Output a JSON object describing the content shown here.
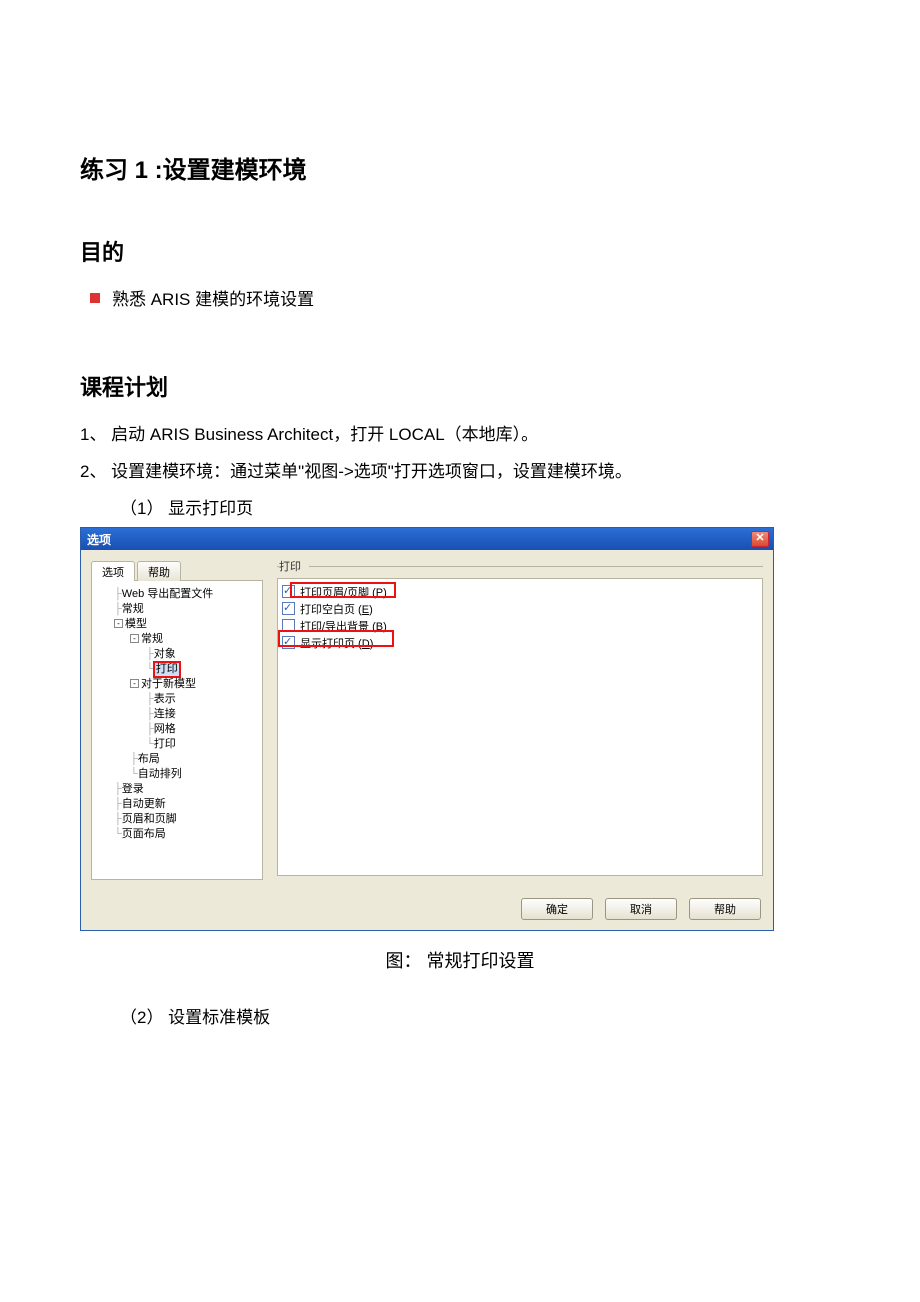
{
  "doc": {
    "title": "练习 1 :设置建模环境",
    "section_goal": "目的",
    "goal_bullet": "熟悉 ARIS 建模的环境设置",
    "section_plan": "课程计划",
    "step1": "1、 启动 ARIS Business Architect，打开 LOCAL（本地库）。",
    "step2": "2、 设置建模环境：通过菜单\"视图->选项\"打开选项窗口，设置建模环境。",
    "sub1": "（1） 显示打印页",
    "sub2": "（2） 设置标准模板",
    "figcap": "图： 常规打印设置"
  },
  "dialog": {
    "title": "选项",
    "tab_options": "选项",
    "tab_help": "帮助",
    "group_label": "打印",
    "checks": [
      {
        "label": "打印页眉/页脚 (P)",
        "checked": true,
        "hotkey": "P"
      },
      {
        "label": "打印空白页 (E)",
        "checked": true,
        "hotkey": "E"
      },
      {
        "label": "打印/导出背景 (B)",
        "checked": false,
        "hotkey": "B"
      },
      {
        "label": "显示打印页 (D)",
        "checked": true,
        "hotkey": "D"
      }
    ],
    "tree": {
      "n0": "Web 导出配置文件",
      "n1": "常规",
      "n2": "模型",
      "n2a": "常规",
      "n2a1": "对象",
      "n2a2": "打印",
      "n2b": "对于新模型",
      "n2b1": "表示",
      "n2b2": "连接",
      "n2b3": "网格",
      "n2b4": "打印",
      "n2c": "布局",
      "n2d": "自动排列",
      "n3": "登录",
      "n4": "自动更新",
      "n5": "页眉和页脚",
      "n6": "页面布局"
    },
    "buttons": {
      "ok": "确定",
      "cancel": "取消",
      "help": "帮助"
    }
  }
}
